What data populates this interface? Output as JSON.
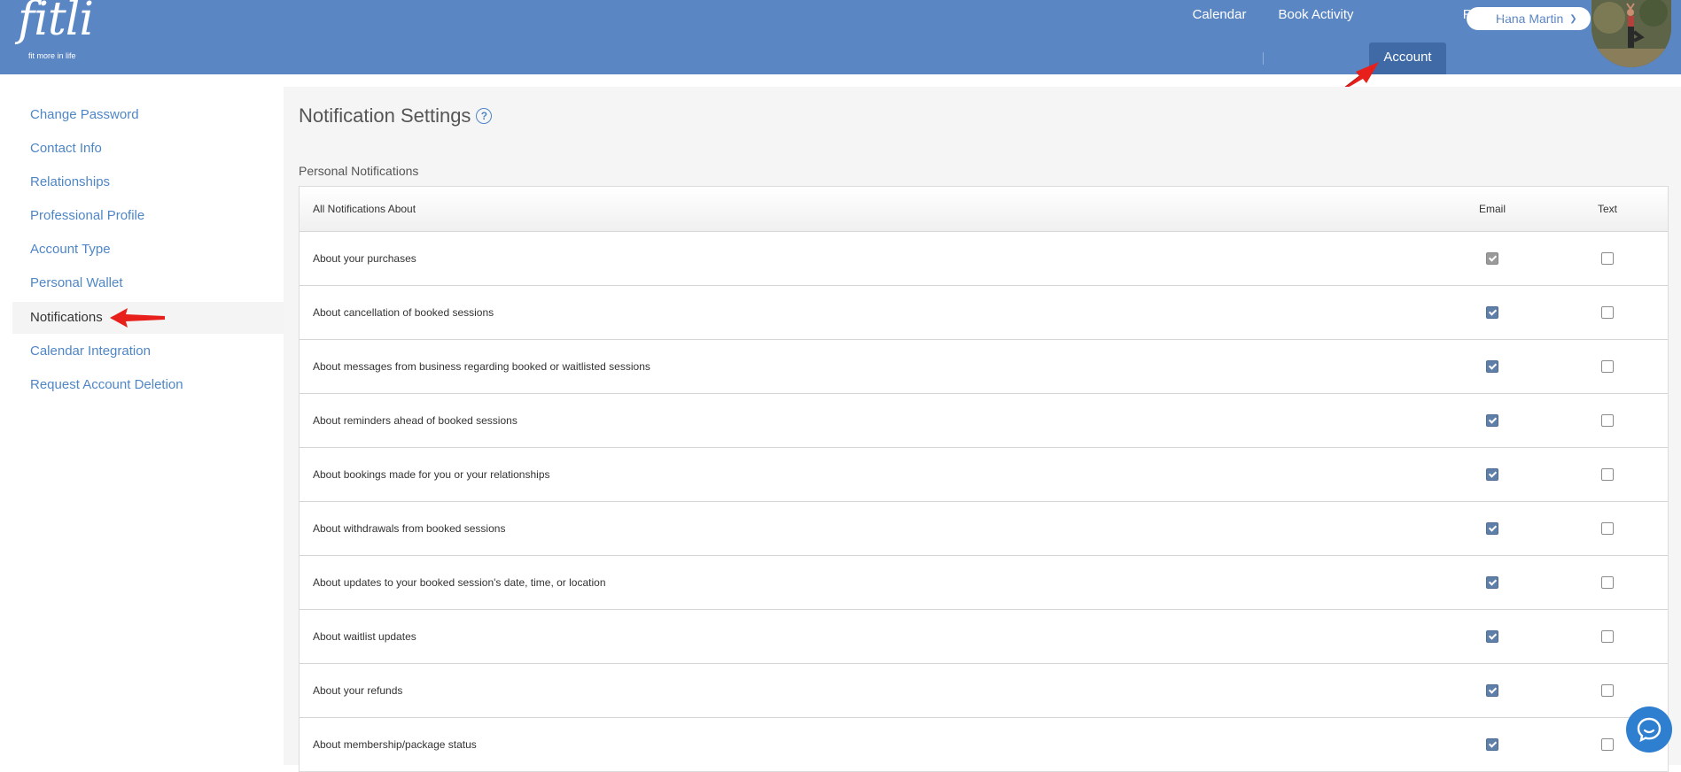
{
  "brand": {
    "name": "fitli",
    "tagline": "fit more in life"
  },
  "user": {
    "name": "Hana Martin"
  },
  "nav": [
    {
      "label": "Calendar"
    },
    {
      "label": "Book Activity"
    },
    {
      "label": "Account"
    },
    {
      "label": "Reports"
    }
  ],
  "sidebar": {
    "items": [
      {
        "label": "Change Password"
      },
      {
        "label": "Contact Info"
      },
      {
        "label": "Relationships"
      },
      {
        "label": "Professional Profile"
      },
      {
        "label": "Account Type"
      },
      {
        "label": "Personal Wallet"
      },
      {
        "label": "Notifications"
      },
      {
        "label": "Calendar Integration"
      },
      {
        "label": "Request Account Deletion"
      }
    ],
    "active_label": "Notifications"
  },
  "main": {
    "title": "Notification Settings",
    "help_icon_glyph": "?",
    "section_label": "Personal Notifications",
    "table": {
      "headers": {
        "label": "All Notifications About",
        "email": "Email",
        "text": "Text"
      },
      "rows": [
        {
          "label": "About your purchases",
          "email": true,
          "email_disabled": true,
          "text": false
        },
        {
          "label": "About cancellation of booked sessions",
          "email": true,
          "text": false
        },
        {
          "label": "About messages from business regarding booked or waitlisted sessions",
          "email": true,
          "text": false
        },
        {
          "label": "About reminders ahead of booked sessions",
          "email": true,
          "text": false
        },
        {
          "label": "About bookings made for you or your relationships",
          "email": true,
          "text": false
        },
        {
          "label": "About withdrawals from booked sessions",
          "email": true,
          "text": false
        },
        {
          "label": "About updates to your booked session's date, time, or location",
          "email": true,
          "text": false
        },
        {
          "label": "About waitlist updates",
          "email": true,
          "text": false
        },
        {
          "label": "About your refunds",
          "email": true,
          "text": false
        },
        {
          "label": "About membership/package status",
          "email": true,
          "text": false
        }
      ]
    }
  },
  "colors": {
    "header": "#5b86c4",
    "nav_active": "#3f6aa6",
    "link": "#4f86c6",
    "annotation_arrow": "#e8201c",
    "chat": "#2f7fd0"
  },
  "icons": [
    "help-icon",
    "chevron-down-icon",
    "chat-icon",
    "red-arrow-annotation"
  ]
}
